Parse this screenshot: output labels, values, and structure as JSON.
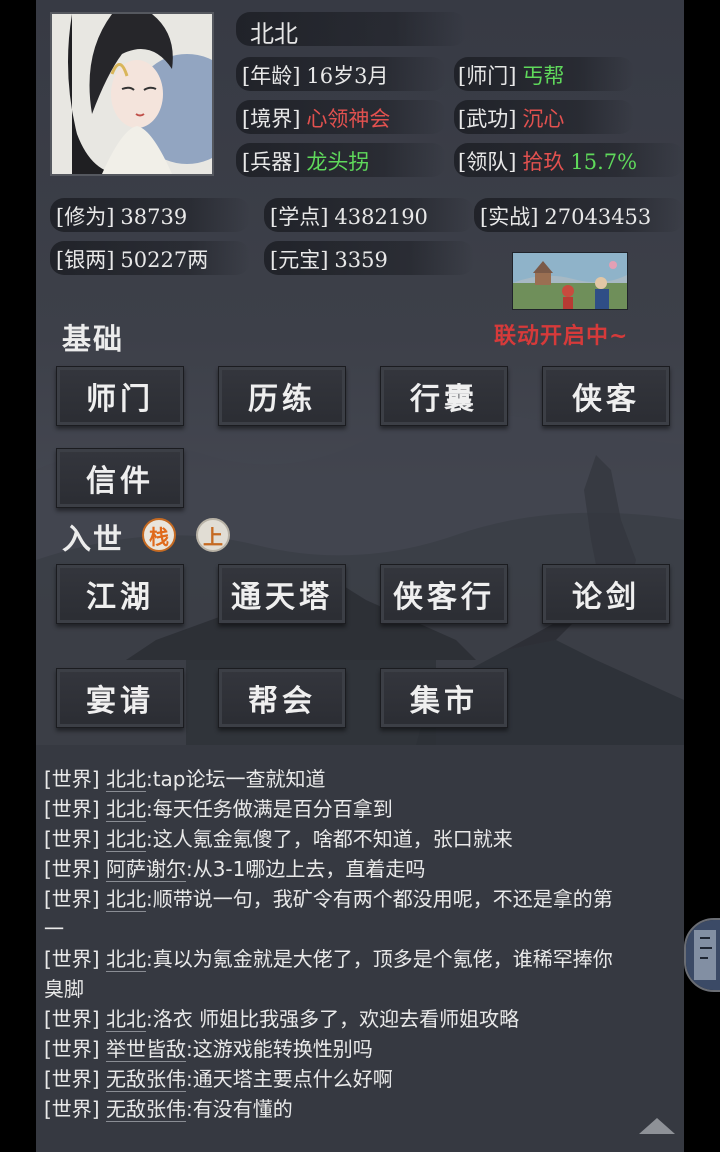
{
  "profile": {
    "name": "北北",
    "age_label": "[年龄]",
    "age": "16岁3月",
    "sect_label": "[师门]",
    "sect": "丐帮",
    "realm_label": "[境界]",
    "realm": "心领神会",
    "skill_label": "[武功]",
    "skill": "沉心",
    "weapon_label": "[兵器]",
    "weapon": "龙头拐",
    "team_label": "[领队]",
    "team": "拾玖",
    "team_pct": "15.7%",
    "cultivation_label": "[修为]",
    "cultivation": "38739",
    "study_label": "[学点]",
    "study": "4382190",
    "combat_label": "[实战]",
    "combat": "27043453",
    "silver_label": "[银两]",
    "silver": "50227两",
    "yuanbao_label": "[元宝]",
    "yuanbao": "3359"
  },
  "collab": {
    "text": "联动开启中~"
  },
  "basic": {
    "title": "基础",
    "buttons": [
      "师门",
      "历练",
      "行囊",
      "侠客",
      "信件"
    ]
  },
  "world": {
    "title": "入世",
    "badge_inn": "栈",
    "badge_up": "上",
    "buttons": [
      "江湖",
      "通天塔",
      "侠客行",
      "论剑",
      "宴请",
      "帮会",
      "集市"
    ]
  },
  "chat": [
    {
      "ch": "[世界]",
      "name": "北北",
      "msg": ":tap论坛一查就知道"
    },
    {
      "ch": "[世界]",
      "name": "北北",
      "msg": ":每天任务做满是百分百拿到"
    },
    {
      "ch": "[世界]",
      "name": "北北",
      "msg": ":这人氪金氪傻了，啥都不知道，张口就来"
    },
    {
      "ch": "[世界]",
      "name": "阿萨谢尔",
      "msg": ":从3-1哪边上去，直着走吗"
    },
    {
      "ch": "[世界]",
      "name": "北北",
      "msg": ":顺带说一句，我矿令有两个都没用呢，不还是拿的第",
      "cont": "一"
    },
    {
      "ch": "[世界]",
      "name": "北北",
      "msg": ":真以为氪金就是大佬了，顶多是个氪佬，谁稀罕捧你",
      "cont": "臭脚"
    },
    {
      "ch": "[世界]",
      "name": "北北",
      "msg": ":洛衣 师姐比我强多了，欢迎去看师姐攻略"
    },
    {
      "ch": "[世界]",
      "name": "举世皆敌",
      "msg": ":这游戏能转换性别吗"
    },
    {
      "ch": "[世界]",
      "name": "无敌张伟",
      "msg": ":通天塔主要点什么好啊"
    },
    {
      "ch": "[世界]",
      "name": "无敌张伟",
      "msg": ":有没有懂的"
    }
  ],
  "colors": {
    "green": "#5fd95b",
    "red": "#e2514f",
    "collab_red": "#d63a3a",
    "badge_orange": "#e06a1b"
  },
  "icons": {
    "scroll_top": "triangle-up-icon",
    "portrait": "character-portrait",
    "collab": "collab-banner"
  }
}
